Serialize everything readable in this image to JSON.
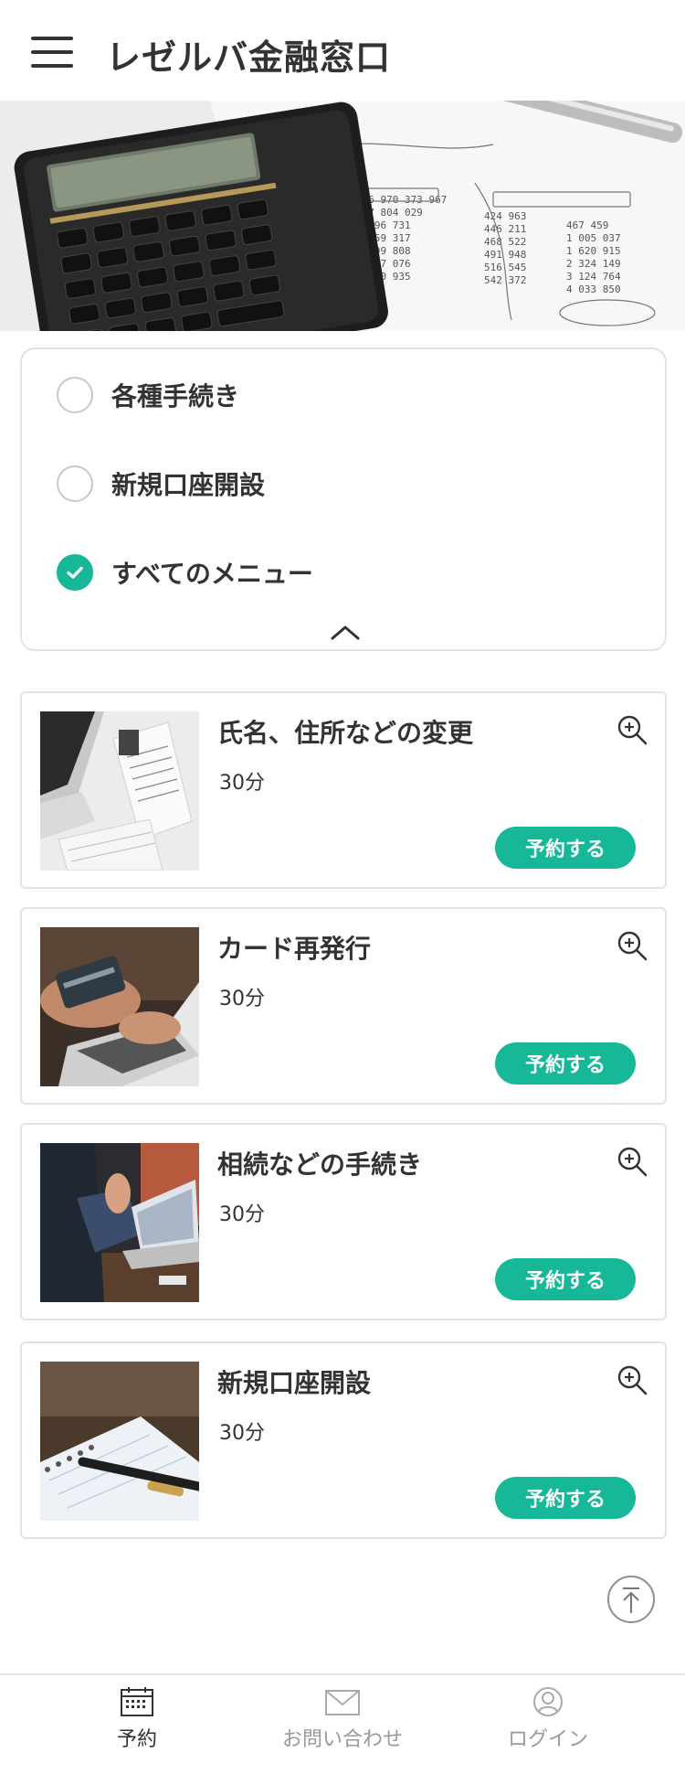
{
  "header": {
    "title": "レゼルバ金融窓口",
    "menu_icon": "hamburger-menu-icon"
  },
  "filter": {
    "options": [
      {
        "label": "各種手続き",
        "checked": false
      },
      {
        "label": "新規口座開設",
        "checked": false
      },
      {
        "label": "すべてのメニュー",
        "checked": true
      }
    ],
    "collapse_icon": "chevron-up-icon"
  },
  "menus": [
    {
      "title": "氏名、住所などの変更",
      "duration": "30分",
      "button": "予約する"
    },
    {
      "title": "カード再発行",
      "duration": "30分",
      "button": "予約する"
    },
    {
      "title": "相続などの手続き",
      "duration": "30分",
      "button": "予約する"
    },
    {
      "title": "新規口座開設",
      "duration": "30分",
      "button": "予約する"
    }
  ],
  "bottom_nav": [
    {
      "label": "予約",
      "icon": "calendar-icon",
      "active": true
    },
    {
      "label": "お問い合わせ",
      "icon": "mail-icon",
      "active": false
    },
    {
      "label": "ログイン",
      "icon": "user-icon",
      "active": false
    }
  ],
  "colors": {
    "accent": "#17b898",
    "text": "#333333",
    "inactive": "#9a9a9a",
    "border": "#e3e3e3"
  }
}
